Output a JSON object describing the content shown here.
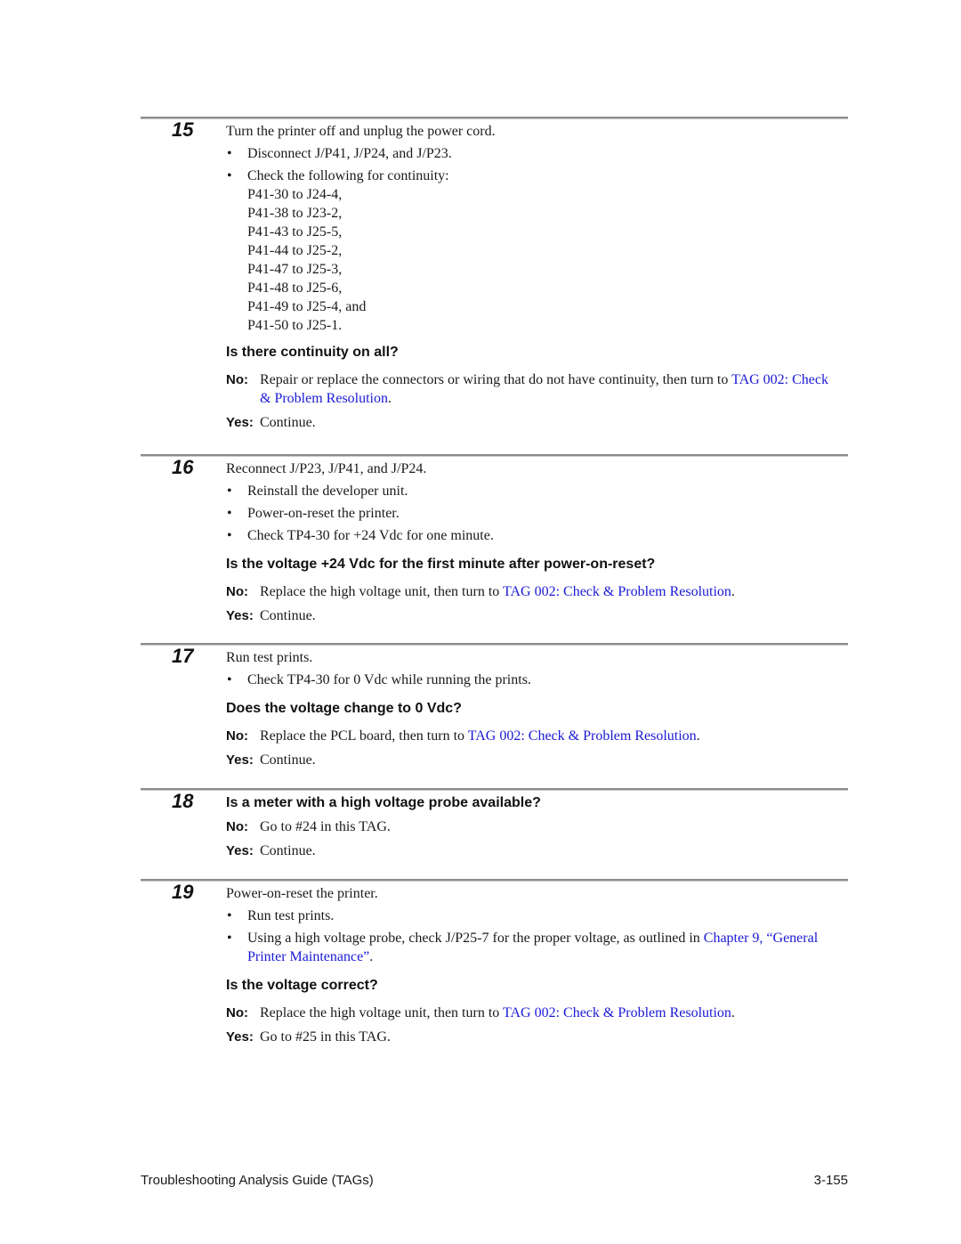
{
  "colors": {
    "link": "#1a1ad6",
    "rule": "#8c8c8c",
    "text": "#1a1a1a"
  },
  "steps": [
    {
      "number": "15",
      "intro": "Turn the printer off and unplug the power cord.",
      "bullets": [
        "Disconnect J/P41, J/P24, and J/P23.",
        "Check the following for continuity:"
      ],
      "continuity_list": [
        "P41-30 to J24-4,",
        "P41-38 to J23-2,",
        "P41-43 to J25-5,",
        "P41-44 to J25-2,",
        "P41-47 to J25-3,",
        "P41-48 to J25-6,",
        "P41-49 to J25-4, and",
        "P41-50 to J25-1."
      ],
      "question": "Is there continuity on all?",
      "no_label": "No:",
      "no_text": "Repair or replace the connectors or wiring that do not have continuity, then turn to ",
      "no_link": "TAG 002: Check & Problem Resolution",
      "no_end": ".",
      "yes_label": "Yes:",
      "yes_text": "Continue."
    },
    {
      "number": "16",
      "intro": "Reconnect J/P23, J/P41, and J/P24.",
      "bullets": [
        "Reinstall the developer unit.",
        "Power-on-reset the printer.",
        "Check TP4-30 for +24 Vdc for one minute."
      ],
      "question": "Is the voltage +24 Vdc for the first minute after power-on-reset?",
      "no_label": "No:",
      "no_text": "Replace the high voltage unit, then turn to ",
      "no_link": "TAG 002: Check & Problem Resolution",
      "no_end": ".",
      "yes_label": "Yes:",
      "yes_text": "Continue."
    },
    {
      "number": "17",
      "intro": "Run test prints.",
      "bullets": [
        "Check TP4-30 for 0 Vdc while running the prints."
      ],
      "question": "Does the voltage change to 0 Vdc?",
      "no_label": "No:",
      "no_text": "Replace the PCL board, then turn to ",
      "no_link": "TAG 002: Check & Problem Resolution",
      "no_end": ".",
      "yes_label": "Yes:",
      "yes_text": "Continue."
    },
    {
      "number": "18",
      "question": "Is a meter with a high voltage probe available?",
      "no_label": "No:",
      "no_text": "Go to #24 in this TAG.",
      "yes_label": "Yes:",
      "yes_text": "Continue."
    },
    {
      "number": "19",
      "intro": "Power-on-reset the printer.",
      "bullets": [
        "Run test prints.",
        "Using a high voltage probe, check J/P25-7 for the proper voltage, as outlined in "
      ],
      "bullet_link": "Chapter 9, “General Printer Maintenance”",
      "bullet_end": ".",
      "question": "Is the voltage correct?",
      "no_label": "No:",
      "no_text": "Replace the high voltage unit, then turn to ",
      "no_link": "TAG 002: Check & Problem Resolution",
      "no_end": ".",
      "yes_label": "Yes:",
      "yes_text": "Go to #25 in this TAG."
    }
  ],
  "bullet_glyph": "•",
  "footer": {
    "title": "Troubleshooting Analysis Guide (TAGs)",
    "page_number": "3-155"
  }
}
